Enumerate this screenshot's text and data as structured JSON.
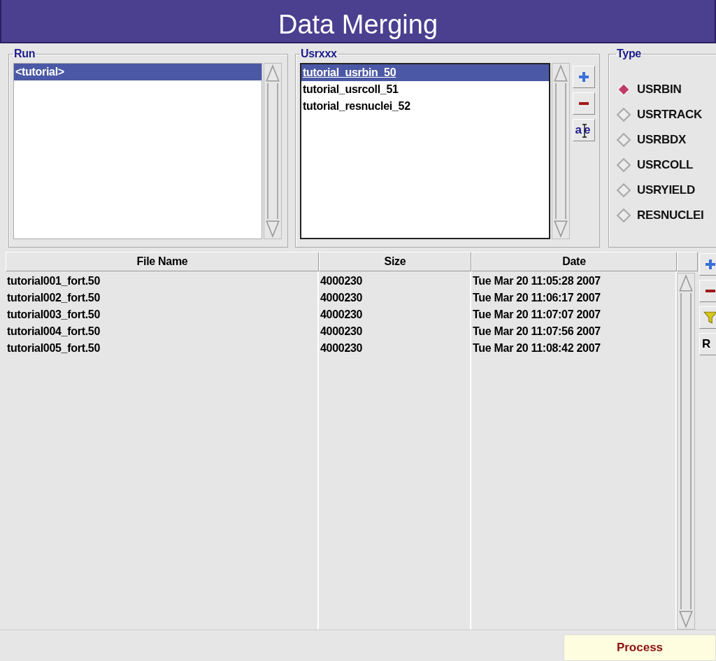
{
  "window": {
    "title": "Data Merging"
  },
  "run": {
    "label": "Run",
    "items": [
      {
        "text": "<tutorial>",
        "selected": true
      }
    ]
  },
  "usrxxx": {
    "label": "Usrxxx",
    "items": [
      {
        "text": "tutorial_usrbin_50",
        "selected": true
      },
      {
        "text": "tutorial_usrcoll_51",
        "selected": false
      },
      {
        "text": "tutorial_resnuclei_52",
        "selected": false
      }
    ],
    "buttons": [
      {
        "kind": "add"
      },
      {
        "kind": "remove"
      },
      {
        "kind": "rename",
        "label": "ae"
      }
    ]
  },
  "type": {
    "label": "Type",
    "options": [
      {
        "label": "USRBIN",
        "selected": true
      },
      {
        "label": "USRTRACK",
        "selected": false
      },
      {
        "label": "USRBDX",
        "selected": false
      },
      {
        "label": "USRCOLL",
        "selected": false
      },
      {
        "label": "USRYIELD",
        "selected": false
      },
      {
        "label": "RESNUCLEI",
        "selected": false
      }
    ]
  },
  "table": {
    "columns": [
      "File Name",
      "Size",
      "Date"
    ],
    "rows": [
      [
        "tutorial001_fort.50",
        "4000230",
        "Tue Mar 20 11:05:28 2007"
      ],
      [
        "tutorial002_fort.50",
        "4000230",
        "Tue Mar 20 11:06:17 2007"
      ],
      [
        "tutorial003_fort.50",
        "4000230",
        "Tue Mar 20 11:07:07 2007"
      ],
      [
        "tutorial004_fort.50",
        "4000230",
        "Tue Mar 20 11:07:56 2007"
      ],
      [
        "tutorial005_fort.50",
        "4000230",
        "Tue Mar 20 11:08:42 2007"
      ]
    ],
    "buttons": [
      {
        "kind": "add"
      },
      {
        "kind": "remove"
      },
      {
        "kind": "filter"
      },
      {
        "kind": "text",
        "label": "R"
      }
    ]
  },
  "process_button": {
    "label": "Process"
  }
}
